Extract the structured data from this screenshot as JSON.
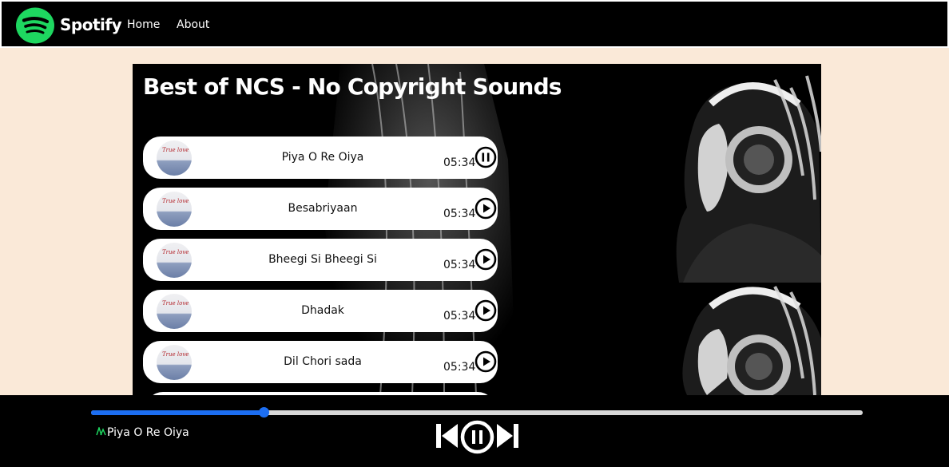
{
  "nav": {
    "brand": "Spotify",
    "links": [
      "Home",
      "About"
    ]
  },
  "playlist": {
    "title": "Best of NCS - No Copyright Sounds",
    "cover_caption": "True love",
    "songs": [
      {
        "name": "Piya O Re Oiya",
        "duration": "05:34",
        "state": "pause"
      },
      {
        "name": "Besabriyaan",
        "duration": "05:34",
        "state": "play"
      },
      {
        "name": "Bheegi Si Bheegi Si",
        "duration": "05:34",
        "state": "play"
      },
      {
        "name": "Dhadak",
        "duration": "05:34",
        "state": "play"
      },
      {
        "name": "Dil Chori sada",
        "duration": "05:34",
        "state": "play"
      }
    ]
  },
  "player": {
    "now_playing": "Piya O Re Oiya",
    "progress": 0.224,
    "state": "paused-icon"
  },
  "colors": {
    "brand_green": "#1ed760",
    "progress_blue": "#1c6ef2",
    "page_bg": "#fae9d8"
  },
  "icons": [
    "spotify-logo-icon",
    "pause-circle-icon",
    "play-circle-icon",
    "previous-icon",
    "next-icon",
    "playing-gif-icon"
  ]
}
